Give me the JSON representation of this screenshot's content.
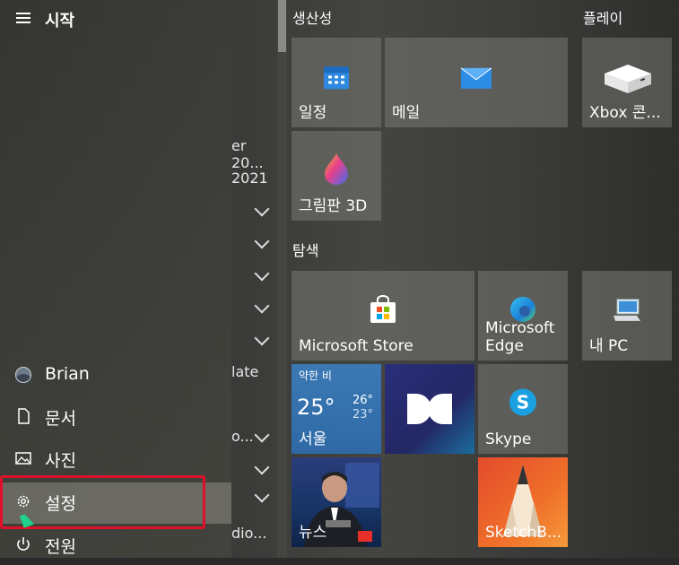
{
  "header": {
    "title": "시작"
  },
  "applist_fragments": [
    "er 20...",
    "2021",
    "late",
    "o...",
    "dio..."
  ],
  "nav": [
    {
      "label": "Brian",
      "icon": "user-avatar-icon"
    },
    {
      "label": "문서",
      "icon": "document-icon"
    },
    {
      "label": "사진",
      "icon": "pictures-icon"
    },
    {
      "label": "설정",
      "icon": "gear-icon"
    },
    {
      "label": "전원",
      "icon": "power-icon"
    }
  ],
  "groups": {
    "productivity": "생산성",
    "play": "플레이",
    "explore": "탐색"
  },
  "tiles": {
    "calendar": "일정",
    "mail": "메일",
    "xbox": "Xbox 콘...",
    "paint3d": "그림판 3D",
    "store": "Microsoft Store",
    "edge": "Microsoft Edge",
    "mypc": "내 PC",
    "weather_cond": "약한 비",
    "weather_temp": "25°",
    "weather_high": "26°",
    "weather_low": "23°",
    "weather_city": "서울",
    "skype": "Skype",
    "news": "뉴스",
    "sketchbook": "SketchB..."
  },
  "colors": {
    "highlight": "#e0102a",
    "cursor": "#1fd18a"
  }
}
